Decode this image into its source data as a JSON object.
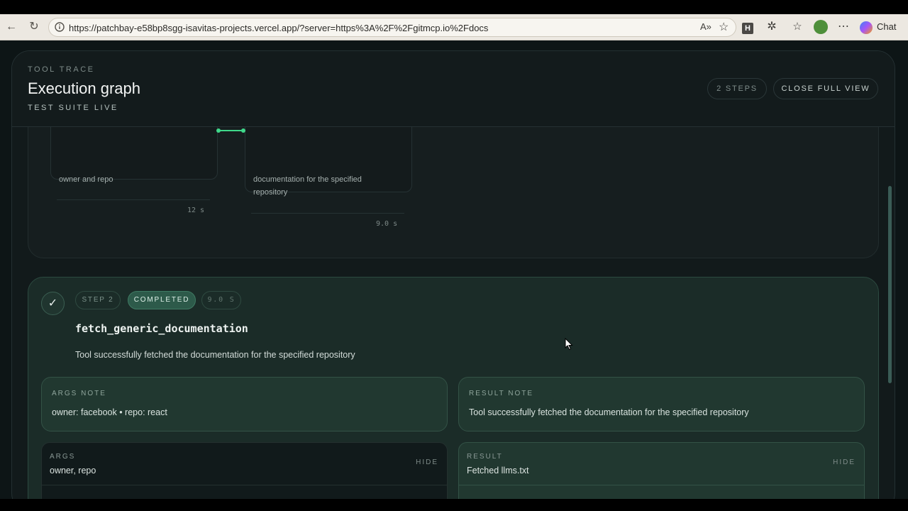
{
  "browser": {
    "url": "https://patchbay-e58bp8sgg-isavitas-projects.vercel.app/?server=https%3A%2F%2Fgitmcp.io%2Fdocs",
    "chat_label": "Chat",
    "extension_badge": "H"
  },
  "header": {
    "eyebrow": "TOOL TRACE",
    "title": "Execution graph",
    "subtitle": "TEST SUITE LIVE",
    "steps_pill": "2 STEPS",
    "close_button": "CLOSE FULL VIEW"
  },
  "graph": {
    "nodes": [
      {
        "desc_lines": [
          "owner and repo"
        ],
        "time": "12 s"
      },
      {
        "desc_lines": [
          "documentation for the specified",
          "repository"
        ],
        "time": "9.0 s"
      }
    ]
  },
  "step": {
    "step_label": "STEP 2",
    "status": "COMPLETED",
    "duration": "9.0 S",
    "tool_name": "fetch_generic_documentation",
    "description": "Tool successfully fetched the documentation for the specified repository",
    "args_note": {
      "label": "ARGS NOTE",
      "text": "owner: facebook • repo: react"
    },
    "result_note": {
      "label": "RESULT NOTE",
      "text": "Tool successfully fetched the documentation for the specified repository"
    },
    "args": {
      "label": "ARGS",
      "value": "owner, repo",
      "toggle": "HIDE"
    },
    "result": {
      "label": "RESULT",
      "value": "Fetched llms.txt",
      "toggle": "HIDE"
    }
  },
  "colors": {
    "accent_green": "#3fd88a",
    "completed_chip": "#2d5a4a",
    "step_card": "#1b2c28"
  }
}
